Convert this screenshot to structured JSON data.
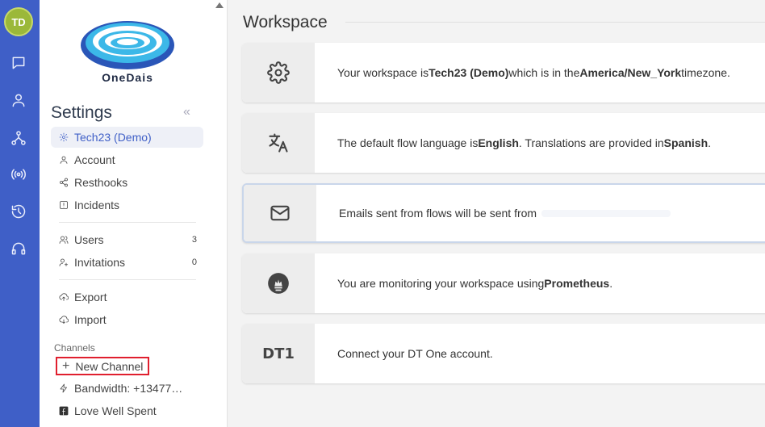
{
  "user": {
    "initials": "TD"
  },
  "brand": {
    "name": "OneDais"
  },
  "sidebar": {
    "title": "Settings",
    "collapse_glyph": "«",
    "items": [
      {
        "label": "Tech23 (Demo)",
        "icon": "gear-icon"
      },
      {
        "label": "Account",
        "icon": "user-icon"
      },
      {
        "label": "Resthooks",
        "icon": "share-icon"
      },
      {
        "label": "Incidents",
        "icon": "alert-icon"
      },
      {
        "label": "Users",
        "icon": "users-icon",
        "count": "3"
      },
      {
        "label": "Invitations",
        "icon": "user-plus-icon",
        "count": "0"
      },
      {
        "label": "Export",
        "icon": "cloud-upload-icon"
      },
      {
        "label": "Import",
        "icon": "cloud-download-icon"
      }
    ],
    "channels_label": "Channels",
    "new_channel": "New Channel",
    "channels": [
      {
        "label": "Bandwidth: +13477…",
        "icon": "bolt-icon"
      },
      {
        "label": "Love Well Spent",
        "icon": "facebook-icon"
      }
    ]
  },
  "main": {
    "title": "Workspace",
    "cards": [
      {
        "icon": "gear-icon",
        "p1": "Your workspace is ",
        "b1": "Tech23 (Demo)",
        "p2": " which is in the ",
        "b2": "America/New_York",
        "p3": " timezone."
      },
      {
        "icon": "translate-icon",
        "p1": "The default flow language is ",
        "b1": "English",
        "p2": ". Translations are provided in ",
        "b2": "Spanish",
        "p3": " ."
      },
      {
        "icon": "mail-icon",
        "p1": "Emails sent from flows will be sent from"
      },
      {
        "icon": "prometheus-icon",
        "p1": "You are monitoring your workspace using ",
        "b1": "Prometheus",
        "p2": "."
      },
      {
        "icon": "dt1-icon",
        "icon_text": "DT1",
        "p1": "Connect your DT One account."
      }
    ]
  },
  "colors": {
    "rail": "#3f5fc7",
    "avatar": "#9bb83a",
    "highlight_border": "#e01f2e"
  }
}
